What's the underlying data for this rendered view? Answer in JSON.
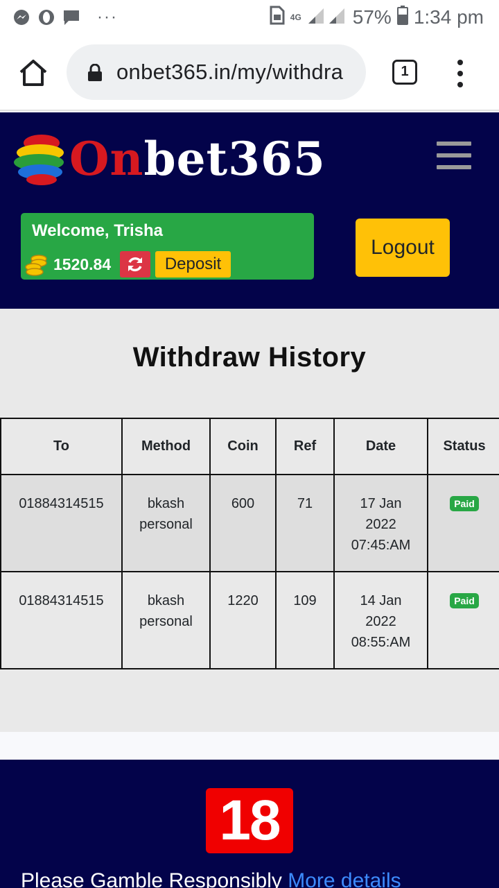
{
  "status_bar": {
    "network_label": "4G",
    "battery_percent": "57%",
    "time": "1:34 pm",
    "overflow": "···",
    "icons": [
      "messenger-icon",
      "opera-icon",
      "chat-icon",
      "sim-icon",
      "signal-icon",
      "battery-icon"
    ]
  },
  "browser": {
    "url": "onbet365.in/my/withdra",
    "tab_count": "1"
  },
  "header": {
    "logo_on": "On",
    "logo_rest": "bet365",
    "welcome": "Welcome, Trisha",
    "balance": "1520.84",
    "deposit_label": "Deposit",
    "logout_label": "Logout"
  },
  "main": {
    "title": "Withdraw History",
    "columns": [
      "To",
      "Method",
      "Coin",
      "Ref",
      "Date",
      "Status"
    ],
    "rows": [
      {
        "to": "01884314515",
        "method_line1": "bkash",
        "method_line2": "personal",
        "coin": "600",
        "ref": "71",
        "date_line1": "17 Jan",
        "date_line2": "2022",
        "date_line3": "07:45:AM",
        "status": "Paid"
      },
      {
        "to": "01884314515",
        "method_line1": "bkash",
        "method_line2": "personal",
        "coin": "1220",
        "ref": "109",
        "date_line1": "14 Jan",
        "date_line2": "2022",
        "date_line3": "08:55:AM",
        "status": "Paid"
      }
    ]
  },
  "footer": {
    "age": "18",
    "text": "Please Gamble Responsibly",
    "link": "More details"
  },
  "colors": {
    "header_bg": "#03034a",
    "welcome_bg": "#28a745",
    "accent_yellow": "#ffc107",
    "refresh_red": "#dc3545",
    "age_red": "#f00000",
    "link_blue": "#3d8bfd"
  }
}
